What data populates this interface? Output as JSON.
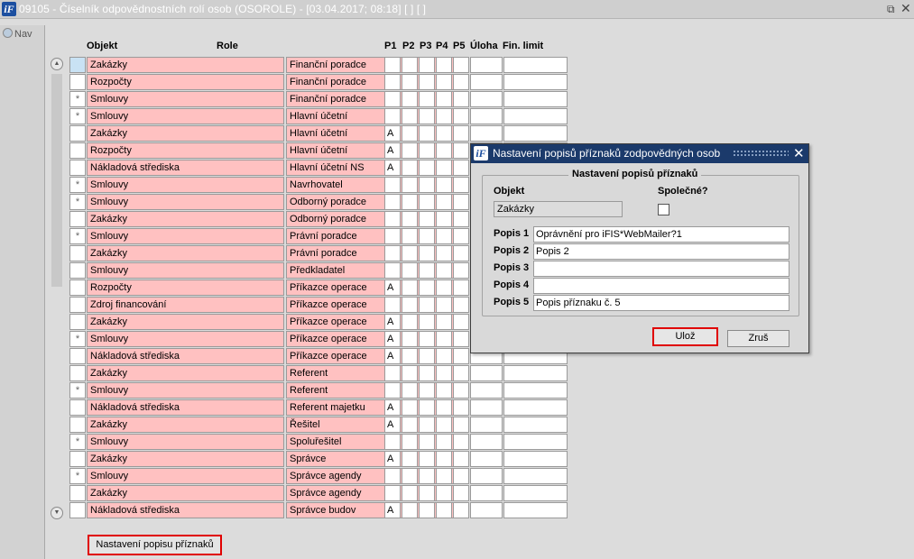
{
  "window": {
    "title": "09105 - Číselník odpovědnostních rolí osob (OSOROLE) - [03.04.2017; 08:18]  [ ]  [ ]",
    "logo": "iF",
    "restore_icon": "restore-icon",
    "close_icon": "close-icon"
  },
  "nav": {
    "label": "Nav"
  },
  "columns": {
    "objekt": "Objekt",
    "role": "Role",
    "p1": "P1",
    "p2": "P2",
    "p3": "P3",
    "p4": "P4",
    "p5": "P5",
    "uloha": "Úloha",
    "fin_limit": "Fin. limit"
  },
  "rows": [
    {
      "mark": "",
      "objekt": "Zakázky",
      "role": "Finanční poradce",
      "p1": ""
    },
    {
      "mark": "",
      "objekt": "Rozpočty",
      "role": "Finanční poradce",
      "p1": ""
    },
    {
      "mark": "*",
      "objekt": "Smlouvy",
      "role": "Finanční poradce",
      "p1": ""
    },
    {
      "mark": "*",
      "objekt": "Smlouvy",
      "role": "Hlavní účetní",
      "p1": ""
    },
    {
      "mark": "",
      "objekt": "Zakázky",
      "role": "Hlavní účetní",
      "p1": "A"
    },
    {
      "mark": "",
      "objekt": "Rozpočty",
      "role": "Hlavní účetní",
      "p1": "A"
    },
    {
      "mark": "",
      "objekt": "Nákladová střediska",
      "role": "Hlavní účetní NS",
      "p1": "A"
    },
    {
      "mark": "*",
      "objekt": "Smlouvy",
      "role": "Navrhovatel",
      "p1": ""
    },
    {
      "mark": "*",
      "objekt": "Smlouvy",
      "role": "Odborný poradce",
      "p1": ""
    },
    {
      "mark": "",
      "objekt": "Zakázky",
      "role": "Odborný poradce",
      "p1": ""
    },
    {
      "mark": "*",
      "objekt": "Smlouvy",
      "role": "Právní poradce",
      "p1": ""
    },
    {
      "mark": "",
      "objekt": "Zakázky",
      "role": "Právní poradce",
      "p1": ""
    },
    {
      "mark": "",
      "objekt": "Smlouvy",
      "role": "Předkladatel",
      "p1": ""
    },
    {
      "mark": "",
      "objekt": "Rozpočty",
      "role": "Příkazce operace",
      "p1": "A"
    },
    {
      "mark": "",
      "objekt": "Zdroj financování",
      "role": "Příkazce operace",
      "p1": ""
    },
    {
      "mark": "",
      "objekt": "Zakázky",
      "role": "Příkazce operace",
      "p1": "A"
    },
    {
      "mark": "*",
      "objekt": "Smlouvy",
      "role": "Příkazce operace",
      "p1": "A"
    },
    {
      "mark": "",
      "objekt": "Nákladová střediska",
      "role": "Příkazce operace",
      "p1": "A"
    },
    {
      "mark": "",
      "objekt": "Zakázky",
      "role": "Referent",
      "p1": ""
    },
    {
      "mark": "*",
      "objekt": "Smlouvy",
      "role": "Referent",
      "p1": ""
    },
    {
      "mark": "",
      "objekt": "Nákladová střediska",
      "role": "Referent majetku",
      "p1": "A"
    },
    {
      "mark": "",
      "objekt": "Zakázky",
      "role": "Řešitel",
      "p1": "A"
    },
    {
      "mark": "*",
      "objekt": "Smlouvy",
      "role": "Spoluřešitel",
      "p1": ""
    },
    {
      "mark": "",
      "objekt": "Zakázky",
      "role": "Správce",
      "p1": "A"
    },
    {
      "mark": "*",
      "objekt": "Smlouvy",
      "role": "Správce agendy",
      "p1": ""
    },
    {
      "mark": "",
      "objekt": "Zakázky",
      "role": "Správce agendy",
      "p1": ""
    },
    {
      "mark": "",
      "objekt": "Nákladová střediska",
      "role": "Správce budov",
      "p1": "A"
    }
  ],
  "bottom_button": "Nastavení popisu příznaků",
  "dialog": {
    "title": "Nastavení popisů příznaků zodpovědných osob",
    "logo": "iF",
    "group_label": "Nastavení popisů příznaků",
    "objekt_label": "Objekt",
    "objekt_value": "Zakázky",
    "spolecne_label": "Společné?",
    "popis_labels": [
      "Popis 1",
      "Popis 2",
      "Popis 3",
      "Popis 4",
      "Popis 5"
    ],
    "popis_values": [
      "Oprávnění pro iFIS*WebMailer?1",
      "Popis 2",
      "",
      "",
      "Popis příznaku č. 5"
    ],
    "save_label": "Ulož",
    "cancel_label": "Zruš"
  },
  "colors": {
    "required_field": "#ffc1c1",
    "dialog_title": "#1b3a6b",
    "highlight": "#e00000"
  }
}
